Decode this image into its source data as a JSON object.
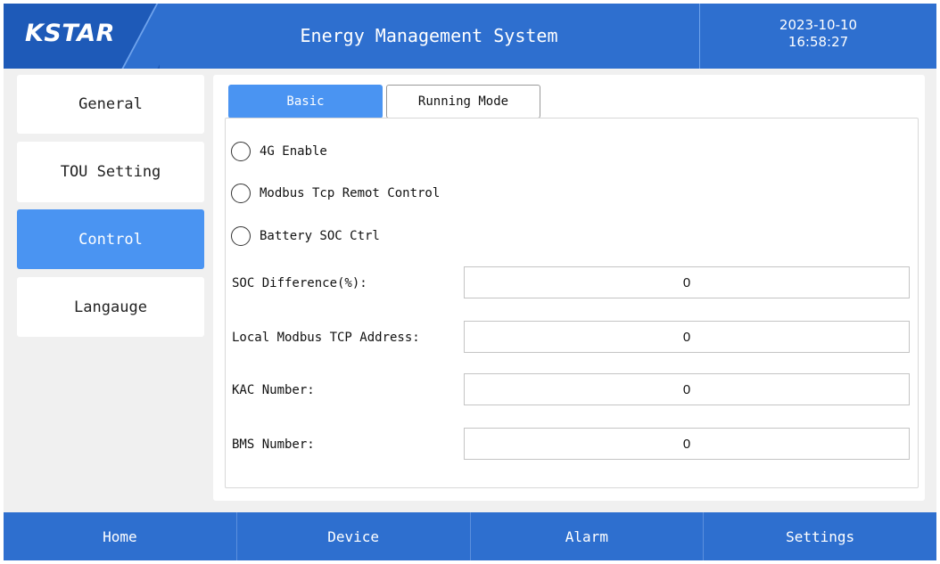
{
  "header": {
    "logo": "KSTAR",
    "title": "Energy Management System",
    "date": "2023-10-10",
    "time": "16:58:27"
  },
  "sidebar": {
    "items": [
      {
        "label": "General"
      },
      {
        "label": "TOU Setting"
      },
      {
        "label": "Control"
      },
      {
        "label": "Langauge"
      }
    ],
    "active": "Control"
  },
  "tabs": [
    {
      "label": "Basic"
    },
    {
      "label": "Running Mode"
    }
  ],
  "options": [
    {
      "label": "4G Enable"
    },
    {
      "label": "Modbus Tcp Remot Control"
    },
    {
      "label": "Battery SOC Ctrl"
    }
  ],
  "fields": [
    {
      "label": "SOC Difference(%):",
      "value": "0"
    },
    {
      "label": "Local Modbus TCP Address:",
      "value": "0"
    },
    {
      "label": "KAC Number:",
      "value": "0"
    },
    {
      "label": "BMS Number:",
      "value": "0"
    }
  ],
  "nav": [
    {
      "label": "Home"
    },
    {
      "label": "Device"
    },
    {
      "label": "Alarm"
    },
    {
      "label": "Settings"
    }
  ],
  "colors": {
    "header_blue": "#2e6fcf",
    "active_blue": "#4a94f2",
    "background": "#f0f0f0"
  }
}
